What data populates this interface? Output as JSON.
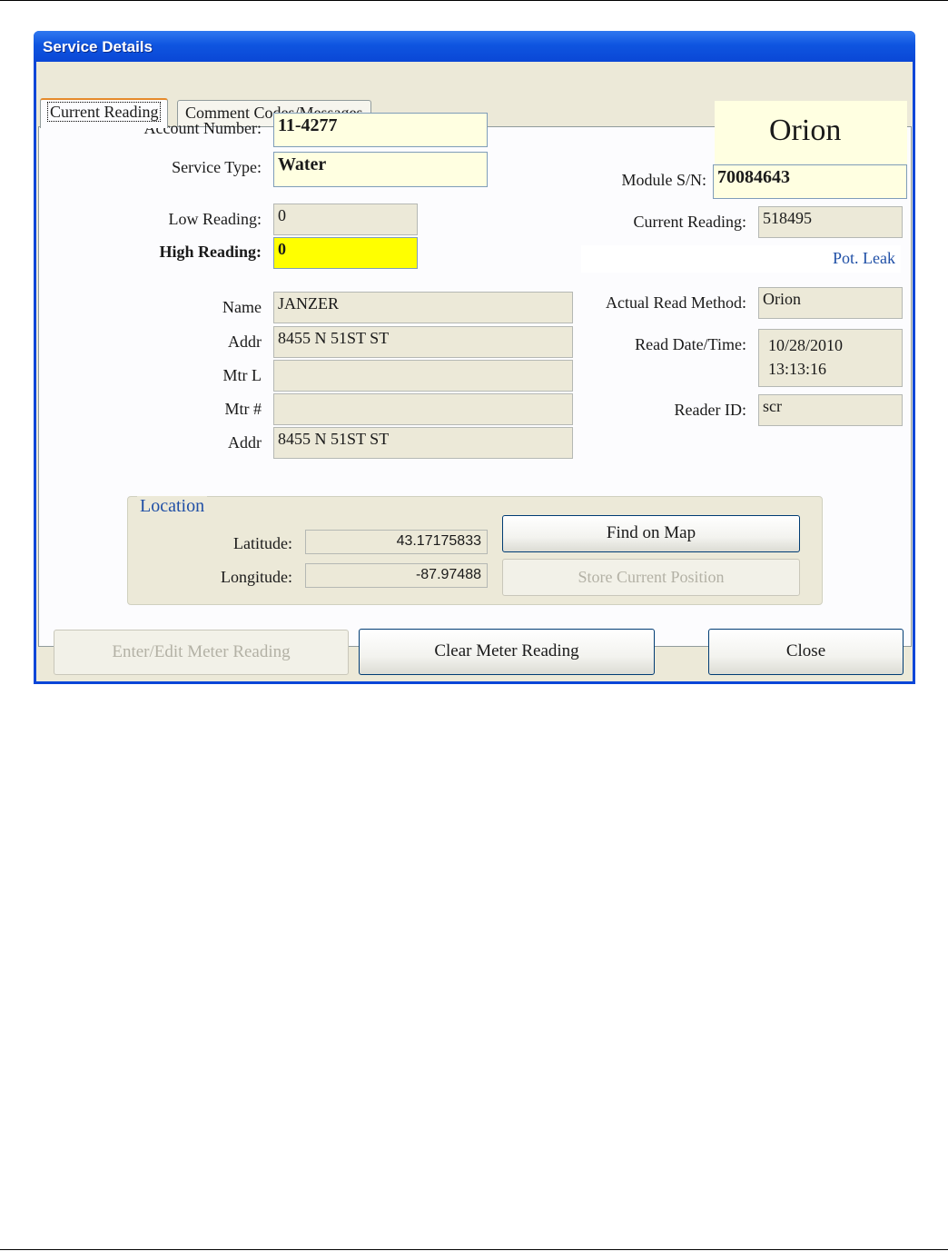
{
  "window": {
    "title": "Service Details"
  },
  "tabs": [
    {
      "label": "Current Reading",
      "active": true
    },
    {
      "label": "Comment Codes/Messages",
      "active": false
    }
  ],
  "fields": {
    "account_number": {
      "label": "Account Number:",
      "value": "11-4277"
    },
    "service_type": {
      "label": "Service Type:",
      "value": "Water"
    },
    "low_reading": {
      "label": "Low Reading:",
      "value": "0"
    },
    "high_reading": {
      "label": "High Reading:",
      "value": "0"
    },
    "name": {
      "label": "Name",
      "value": "JANZER"
    },
    "addr1": {
      "label": "Addr",
      "value": "8455 N 51ST ST"
    },
    "mtr_l": {
      "label": "Mtr L",
      "value": ""
    },
    "mtr_num": {
      "label": "Mtr #",
      "value": ""
    },
    "addr2": {
      "label": "Addr",
      "value": "8455 N 51ST ST"
    },
    "module_sn": {
      "label": "Module S/N:",
      "value": "70084643"
    },
    "current_reading": {
      "label": "Current Reading:",
      "value": "518495"
    },
    "actual_read_method": {
      "label": "Actual Read Method:",
      "value": "Orion"
    },
    "read_date_time": {
      "label": "Read Date/Time:",
      "date": "10/28/2010",
      "time": "13:13:16"
    },
    "reader_id": {
      "label": "Reader ID:",
      "value": "scr"
    }
  },
  "brand": "Orion",
  "alert": "Pot. Leak",
  "location": {
    "title": "Location",
    "latitude_label": "Latitude:",
    "latitude": "43.17175833",
    "longitude_label": "Longitude:",
    "longitude": "-87.97488",
    "find_on_map": "Find on Map",
    "store_position": "Store Current Position"
  },
  "buttons": {
    "enter_edit": "Enter/Edit Meter Reading",
    "clear": "Clear Meter Reading",
    "close": "Close"
  },
  "colors": {
    "title_bar": "#0a46d8",
    "editable_field": "#ffffe1",
    "highlight_field": "#ffff00",
    "accent_text": "#1f4fa6"
  }
}
